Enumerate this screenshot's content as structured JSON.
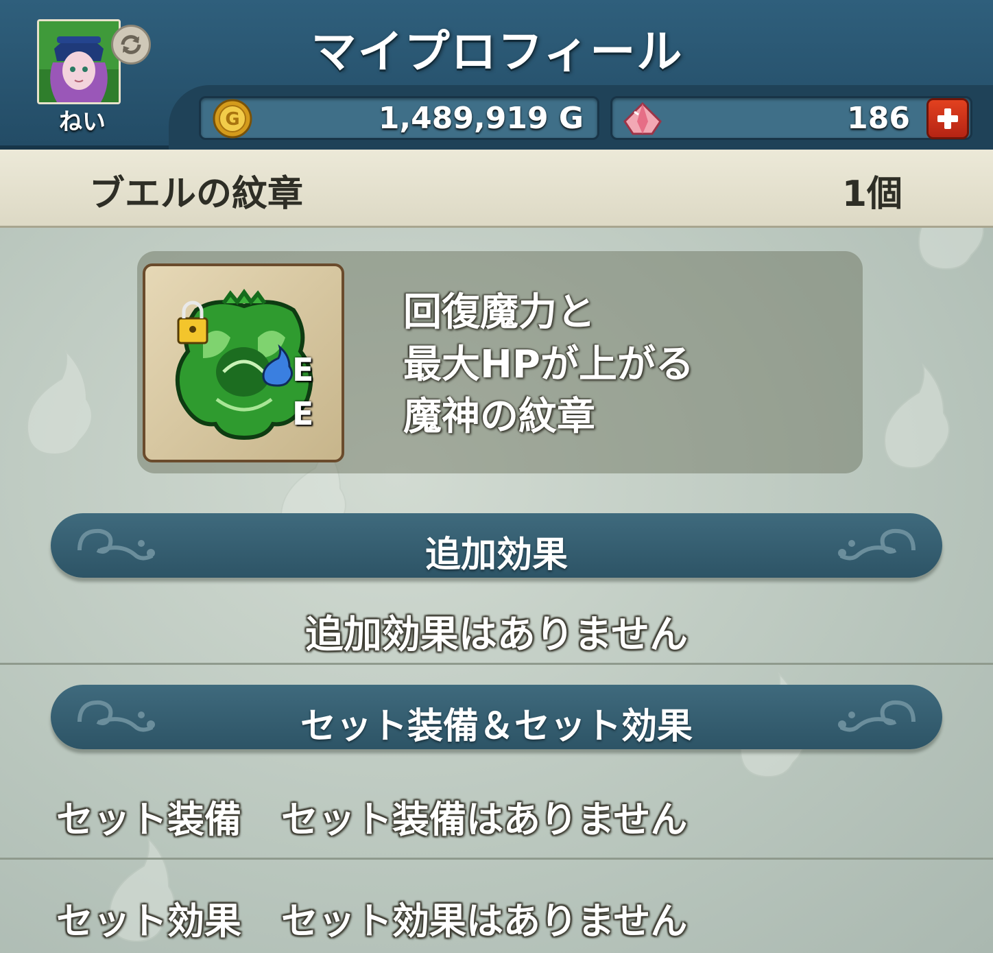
{
  "header": {
    "title": "マイプロフィール",
    "player_name": "ねい",
    "gold": "1,489,919 G",
    "gems": "186"
  },
  "item": {
    "name": "ブエルの紋章",
    "count": "1個",
    "equipped_marks": [
      "E",
      "E"
    ],
    "description": [
      "回復魔力と",
      "最大HPが上がる",
      "魔神の紋章"
    ]
  },
  "extra_effects": {
    "heading": "追加効果",
    "empty_text": "追加効果はありません"
  },
  "set_section": {
    "heading": "セット装備＆セット効果",
    "rows": [
      {
        "label": "セット装備",
        "value": "セット装備はありません"
      },
      {
        "label": "セット効果",
        "value": "セット効果はありません"
      }
    ]
  },
  "colors": {
    "header": "#2f5f7c",
    "banner": "#355e71",
    "item_bar": "#e6e2cf",
    "plus_button": "#d03a1c"
  },
  "icons": [
    "avatar",
    "refresh-icon",
    "gold-coin-icon",
    "gem-icon",
    "plus-icon",
    "emblem-icon",
    "lock-icon",
    "slime-icon",
    "ornament-icon"
  ]
}
